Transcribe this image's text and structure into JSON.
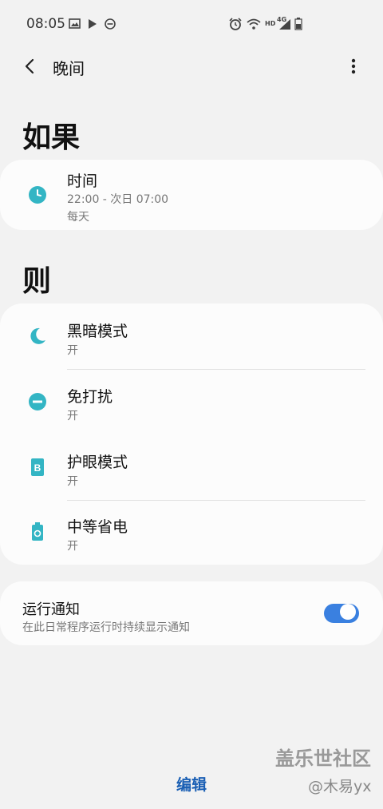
{
  "status_bar": {
    "time": "08:05",
    "left_icons": [
      "image-icon",
      "play-store-icon",
      "dnd-icon"
    ],
    "right_icons": [
      "alarm-icon",
      "wifi-icon",
      "signal-icon",
      "battery-icon"
    ],
    "network_label": "4G",
    "hd_label": "HD"
  },
  "app_bar": {
    "title": "晚间",
    "back_icon": "back-arrow-icon",
    "more_icon": "more-vertical-icon"
  },
  "if_section": {
    "title": "如果",
    "row": {
      "title": "时间",
      "subtitle": "22:00 - 次日 07:00",
      "detail": "每天",
      "icon": "clock-icon"
    }
  },
  "then_section": {
    "title": "则",
    "rows": [
      {
        "title": "黑暗模式",
        "status": "开",
        "icon": "moon-icon"
      },
      {
        "title": "免打扰",
        "status": "开",
        "icon": "dnd-icon"
      },
      {
        "title": "护眼模式",
        "status": "开",
        "icon": "eye-comfort-icon"
      },
      {
        "title": "中等省电",
        "status": "开",
        "icon": "power-saving-icon"
      }
    ]
  },
  "notification": {
    "title": "运行通知",
    "subtitle": "在此日常程序运行时持续显示通知",
    "enabled": true
  },
  "bottom": {
    "edit_label": "编辑"
  },
  "watermark": {
    "line1": "盖乐世社区",
    "line2": "@木易yx"
  },
  "colors": {
    "accent_teal": "#33b5c4",
    "toggle_blue": "#3a80e0",
    "edit_blue": "#1a5fb4"
  }
}
